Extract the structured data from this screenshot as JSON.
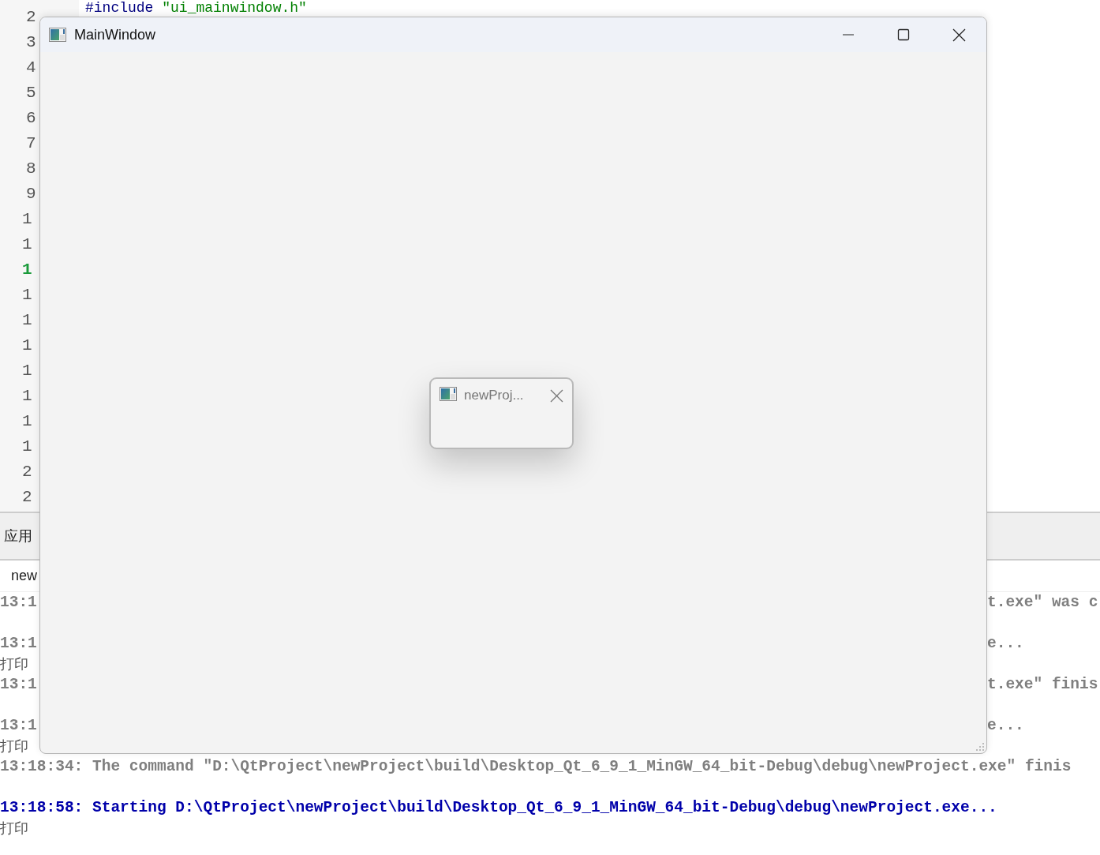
{
  "editor": {
    "line_numbers": [
      {
        "number": "2",
        "kind": "full",
        "current": false
      },
      {
        "number": "3",
        "kind": "full",
        "current": false
      },
      {
        "number": "4",
        "kind": "full",
        "current": false
      },
      {
        "number": "5",
        "kind": "full",
        "current": false
      },
      {
        "number": "6",
        "kind": "full",
        "current": false
      },
      {
        "number": "7",
        "kind": "full",
        "current": false
      },
      {
        "number": "8",
        "kind": "full",
        "current": false
      },
      {
        "number": "9",
        "kind": "full",
        "current": false
      },
      {
        "number": "1",
        "kind": "cut",
        "current": false
      },
      {
        "number": "1",
        "kind": "cut",
        "current": false
      },
      {
        "number": "1",
        "kind": "cut",
        "current": true
      },
      {
        "number": "1",
        "kind": "cut",
        "current": false
      },
      {
        "number": "1",
        "kind": "cut",
        "current": false
      },
      {
        "number": "1",
        "kind": "cut",
        "current": false
      },
      {
        "number": "1",
        "kind": "cut",
        "current": false
      },
      {
        "number": "1",
        "kind": "cut",
        "current": false
      },
      {
        "number": "1",
        "kind": "cut",
        "current": false
      },
      {
        "number": "1",
        "kind": "cut",
        "current": false
      },
      {
        "number": "2",
        "kind": "cut",
        "current": false
      },
      {
        "number": "2",
        "kind": "cut",
        "current": false
      }
    ],
    "code_line": [
      {
        "kind": "directive",
        "text": "#include"
      },
      {
        "kind": "string",
        "text": "\"ui_mainwindow.h\""
      }
    ]
  },
  "output_panel": {
    "title": "应用",
    "tab": "new",
    "lines": [
      {
        "kind": "gray",
        "left": "13:1",
        "right": "t.exe\" was c"
      },
      {
        "kind": "blank"
      },
      {
        "kind": "gray",
        "left": "13:1",
        "right": "e..."
      },
      {
        "kind": "plain",
        "left": "打印"
      },
      {
        "kind": "gray",
        "left": "13:1",
        "right": "t.exe\" finis"
      },
      {
        "kind": "blank"
      },
      {
        "kind": "gray",
        "left": "13:1",
        "right": "e..."
      },
      {
        "kind": "plain",
        "left": "打印"
      },
      {
        "kind": "gray",
        "left": "13:18:34: The command \"D:\\QtProject\\newProject\\build\\Desktop_Qt_6_9_1_MinGW_64_bit-Debug\\debug\\newProject.exe\" finis"
      },
      {
        "kind": "blank"
      },
      {
        "kind": "blue",
        "left": "13:18:58: Starting D:\\QtProject\\newProject\\build\\Desktop_Qt_6_9_1_MinGW_64_bit-Debug\\debug\\newProject.exe..."
      },
      {
        "kind": "plain",
        "left": "打印"
      }
    ]
  },
  "window": {
    "title": "MainWindow"
  },
  "dialog": {
    "title": "newProj..."
  }
}
